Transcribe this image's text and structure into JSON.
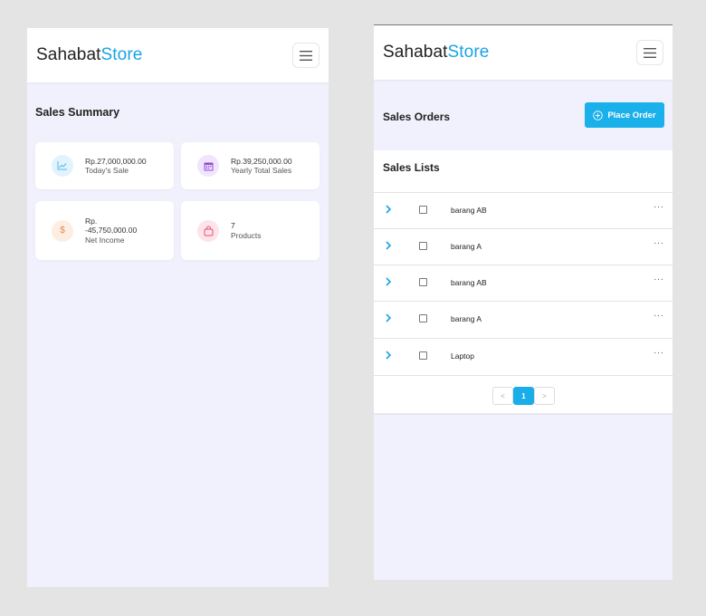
{
  "left": {
    "brand": {
      "part1": "Sahabat",
      "part2": "Store"
    },
    "summary_title": "Sales Summary",
    "cards": [
      {
        "value": "Rp.27,000,000.00",
        "label": "Today's Sale",
        "icon": "line-chart-icon",
        "color": "#5ab4ec",
        "bg": "#e1f3fd"
      },
      {
        "value": "Rp.39,250,000.00",
        "label": "Yearly Total Sales",
        "icon": "calendar-icon",
        "color": "#8f4bd9",
        "bg": "#f0e5fc"
      },
      {
        "value_line1": "Rp.",
        "value_line2": "-45,750,000.00",
        "label": "Net Income",
        "icon": "dollar-icon",
        "color": "#e58a4c",
        "bg": "#fdeee3"
      },
      {
        "value": "7",
        "label": "Products",
        "icon": "shopping-bag-icon",
        "color": "#ee4e7b",
        "bg": "#fde3ea"
      }
    ]
  },
  "right": {
    "brand": {
      "part1": "Sahabat",
      "part2": "Store"
    },
    "orders_title": "Sales Orders",
    "place_order_label": "Place Order",
    "list_title": "Sales Lists",
    "rows": [
      {
        "name": "barang AB"
      },
      {
        "name": "barang A"
      },
      {
        "name": "barang AB"
      },
      {
        "name": "barang A"
      },
      {
        "name": "Laptop"
      }
    ],
    "more_glyph": "···",
    "pagination": {
      "prev": "<",
      "current": "1",
      "next": ">"
    }
  },
  "colors": {
    "accent": "#1aa3e6",
    "button": "#1ab0ea",
    "panel_bg": "#f0f1fc",
    "page_bg": "#e4e4e4"
  }
}
